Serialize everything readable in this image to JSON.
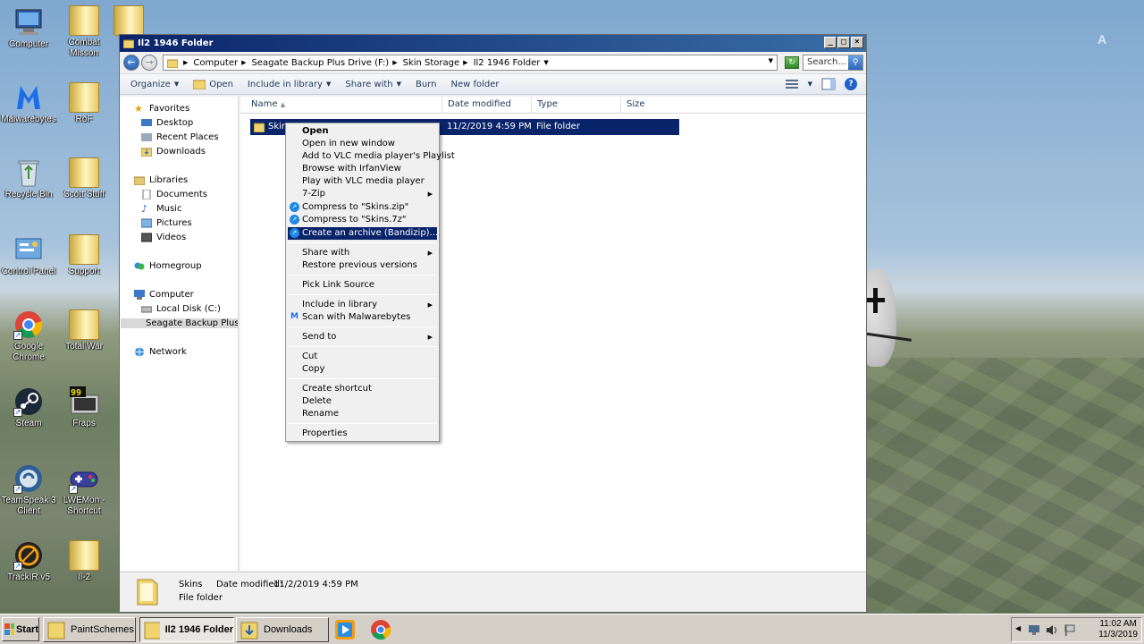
{
  "desktop": {
    "icons": [
      {
        "label": "Computer"
      },
      {
        "label": "Combat Misson"
      },
      {
        "label": "Malwarebytes"
      },
      {
        "label": "RoF"
      },
      {
        "label": "Recycle Bin"
      },
      {
        "label": "Scott Stuff"
      },
      {
        "label": "Control Panel"
      },
      {
        "label": "Support"
      },
      {
        "label": "Google Chrome"
      },
      {
        "label": "Total War"
      },
      {
        "label": "Steam"
      },
      {
        "label": "Fraps"
      },
      {
        "label": "TeamSpeak 3 Client"
      },
      {
        "label": "LWEMon - Shortcut"
      },
      {
        "label": "TrackIR v5"
      },
      {
        "label": "Il-2"
      }
    ],
    "fraps_badge": "99",
    "corner_glyph": "A"
  },
  "window": {
    "title": "Il2 1946 Folder",
    "controls": {
      "minimize": "_",
      "maximize": "□",
      "close": "×"
    },
    "address": {
      "crumbs": [
        "Computer",
        "Seagate Backup Plus Drive (F:)",
        "Skin Storage",
        "Il2 1946 Folder"
      ]
    },
    "search": {
      "placeholder": "Search..."
    },
    "toolbar": {
      "organize": "Organize",
      "open": "Open",
      "include_in_library": "Include in library",
      "share_with": "Share with",
      "burn": "Burn",
      "new_folder": "New folder"
    },
    "nav": {
      "favorites": "Favorites",
      "desktop": "Desktop",
      "recent_places": "Recent Places",
      "downloads": "Downloads",
      "libraries": "Libraries",
      "documents": "Documents",
      "music": "Music",
      "pictures": "Pictures",
      "videos": "Videos",
      "homegroup": "Homegroup",
      "computer": "Computer",
      "local_disk": "Local Disk (C:)",
      "seagate": "Seagate Backup Plus D",
      "network": "Network"
    },
    "columns": {
      "name": "Name",
      "date_modified": "Date modified",
      "type": "Type",
      "size": "Size"
    },
    "files": [
      {
        "name": "Skins",
        "date_modified": "11/2/2019 4:59 PM",
        "type": "File folder",
        "size": ""
      }
    ],
    "details": {
      "name": "Skins",
      "date_label": "Date modified:",
      "date_value": "11/2/2019 4:59 PM",
      "type": "File folder"
    }
  },
  "context_menu": {
    "items": [
      {
        "label": "Open"
      },
      {
        "label": "Open in new window"
      },
      {
        "label": "Add to VLC media player's Playlist"
      },
      {
        "label": "Browse with IrfanView"
      },
      {
        "label": "Play with VLC media player"
      },
      {
        "label": "7-Zip"
      },
      {
        "label": "Compress to \"Skins.zip\""
      },
      {
        "label": "Compress to \"Skins.7z\""
      },
      {
        "label": "Create an archive (Bandizip)..."
      },
      {
        "label": "Share with"
      },
      {
        "label": "Restore previous versions"
      },
      {
        "label": "Pick Link Source"
      },
      {
        "label": "Include in library"
      },
      {
        "label": "Scan with Malwarebytes"
      },
      {
        "label": "Send to"
      },
      {
        "label": "Cut"
      },
      {
        "label": "Copy"
      },
      {
        "label": "Create shortcut"
      },
      {
        "label": "Delete"
      },
      {
        "label": "Rename"
      },
      {
        "label": "Properties"
      }
    ],
    "highlighted": "Create an archive (Bandizip)..."
  },
  "taskbar": {
    "start": "Start",
    "buttons": [
      {
        "label": "PaintSchemes"
      },
      {
        "label": "Il2 1946 Folder"
      },
      {
        "label": "Downloads"
      }
    ],
    "clock": {
      "time": "11:02 AM",
      "date": "11/3/2019"
    }
  },
  "colors": {
    "selection": "#0a246a",
    "title_gradient_start": "#0a246a",
    "title_gradient_end": "#3a6ea5"
  }
}
